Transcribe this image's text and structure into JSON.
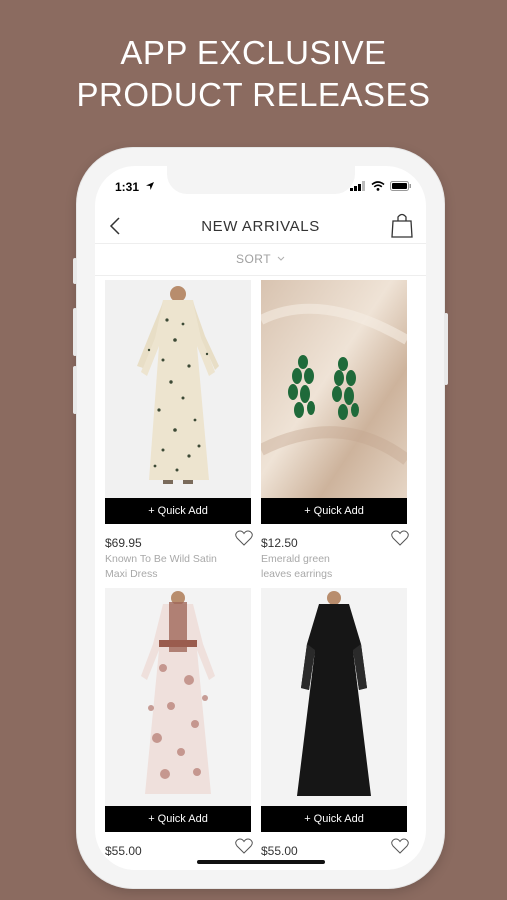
{
  "promo": {
    "line1": "APP EXCLUSIVE",
    "line2": "PRODUCT RELEASES"
  },
  "status_bar": {
    "time": "1:31",
    "icons": [
      "location-arrow-icon",
      "signal-icon",
      "wifi-icon",
      "battery-icon"
    ]
  },
  "header": {
    "title": "NEW ARRIVALS",
    "back_icon": "chevron-left-icon",
    "bag_icon": "shopping-bag-icon"
  },
  "sort": {
    "label": "SORT",
    "icon": "chevron-down-icon"
  },
  "products": [
    {
      "price": "$69.95",
      "name_line1": "Known To Be Wild Satin",
      "name_line2": "Maxi Dress",
      "quick_add": "+ Quick Add",
      "image": "cream-printed-maxi-dress"
    },
    {
      "price": "$12.50",
      "name_line1": "Emerald green",
      "name_line2": "leaves earrings",
      "quick_add": "+ Quick Add",
      "image": "emerald-earrings-on-satin"
    },
    {
      "price": "$55.00",
      "name_line1": "",
      "name_line2": "",
      "quick_add": "+ Quick Add",
      "image": "floral-print-maxi-dress"
    },
    {
      "price": "$55.00",
      "name_line1": "",
      "name_line2": "",
      "quick_add": "+ Quick Add",
      "image": "black-abaya"
    }
  ],
  "colors": {
    "background": "#8b6b60",
    "quick_add": "#000000",
    "text_muted": "#a8a8a8"
  }
}
